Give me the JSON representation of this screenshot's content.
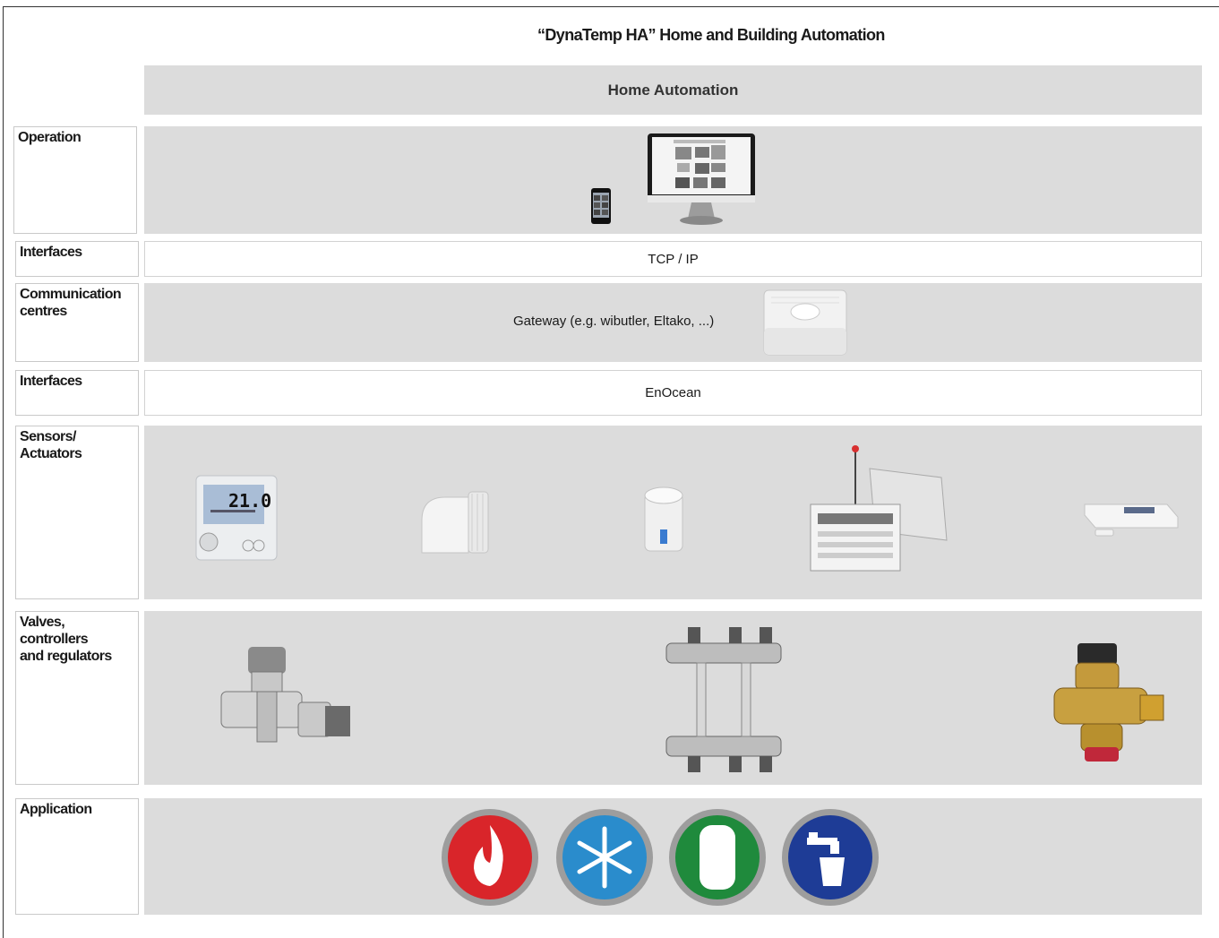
{
  "title": "“DynaTemp HA” Home and Building Automation",
  "column_header": "Home Automation",
  "rows": {
    "operation": "Operation",
    "interfaces_1": "Interfaces",
    "communication": "Communication\ncentres",
    "interfaces_2": "Interfaces",
    "sensors": "Sensors/\nActuators",
    "valves": "Valves,\ncontrollers\nand regulators",
    "application": "Application"
  },
  "bands": {
    "tcp_ip": "TCP / IP",
    "gateway": "Gateway (e.g. wibutler, Eltako, ...)",
    "enocean": "EnOcean"
  },
  "thermostat_display": "21.0",
  "icons": [
    "smartphone-icon",
    "monitor-icon",
    "gateway-device-icon",
    "room-thermostat-icon",
    "thermostatic-head-icon",
    "actuator-icon",
    "control-module-icon",
    "window-contact-sensor-icon",
    "valve-icon",
    "manifold-icon",
    "regulator-valve-icon",
    "heating-flame-icon",
    "cooling-snowflake-icon",
    "storage-tank-icon",
    "drinking-water-icon"
  ],
  "colors": {
    "band_gray": "#dcdcdc",
    "heating": "#d9252a",
    "cooling": "#2a8ccc",
    "storage": "#1f8a3c",
    "water": "#1e3c96"
  }
}
